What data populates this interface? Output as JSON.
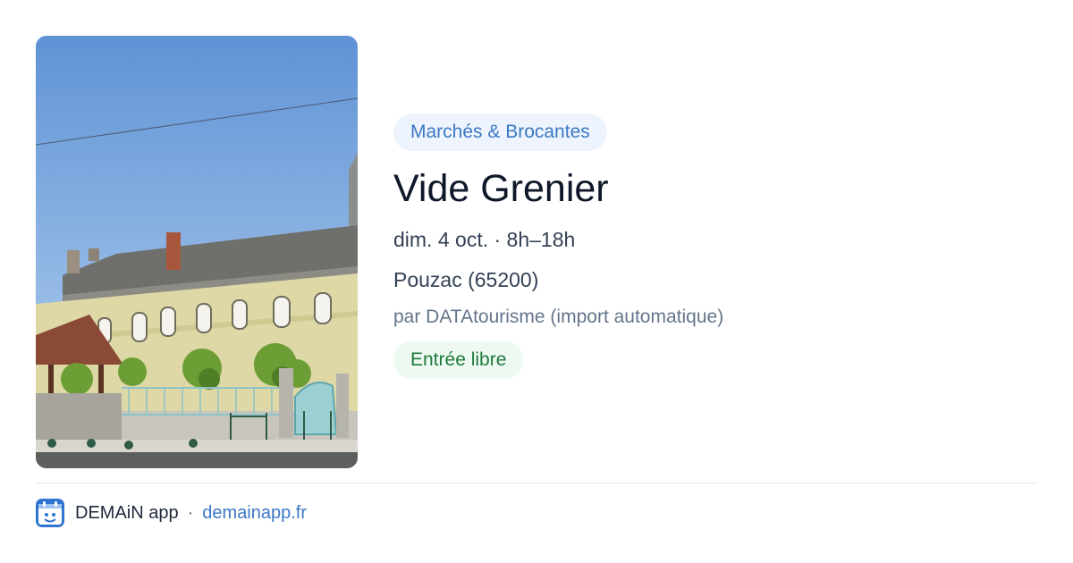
{
  "photo": {
    "alt": ""
  },
  "event": {
    "category": "Marchés & Brocantes",
    "title": "Vide Grenier",
    "date": "dim. 4 oct. · 8h–18h",
    "location": "Pouzac (65200)",
    "source": "par DATAtourisme (import automatique)",
    "price_tag": "Entrée libre"
  },
  "footer": {
    "app_icon": "demain-app-icon",
    "app_name": "DEMAiN app",
    "separator": "·",
    "site": "demainapp.fr"
  },
  "colors": {
    "category_bg": "#eef4fd",
    "category_text": "#3b78c4",
    "price_bg": "#eefaf1",
    "price_text": "#1f7a3d",
    "link": "#3b78c4"
  }
}
